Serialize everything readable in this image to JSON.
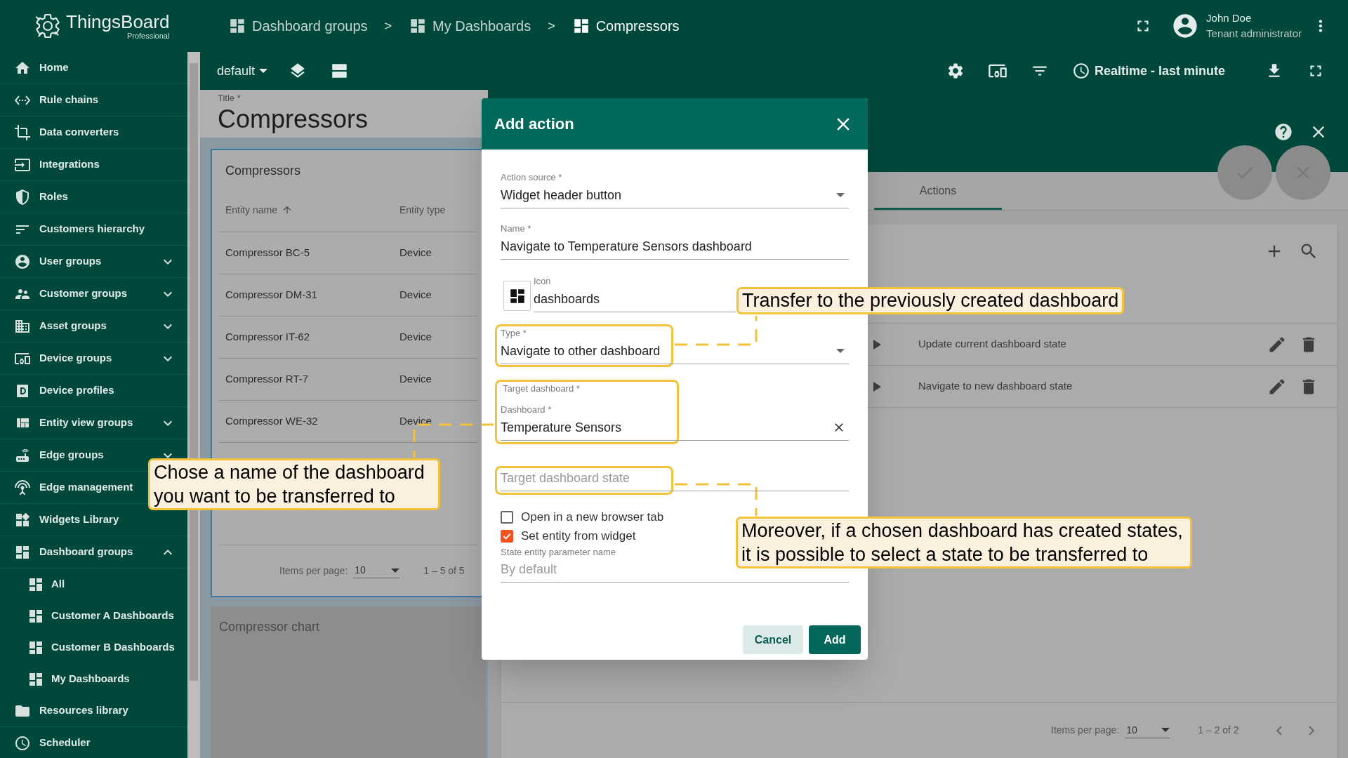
{
  "app": {
    "name": "ThingsBoard",
    "edition": "Professional"
  },
  "breadcrumbs": [
    {
      "label": "Dashboard groups",
      "separator": ">"
    },
    {
      "label": "My Dashboards",
      "separator": ">"
    },
    {
      "label": "Compressors"
    }
  ],
  "user": {
    "name": "John Doe",
    "role": "Tenant administrator"
  },
  "sidebar": {
    "items": [
      {
        "label": "Home",
        "kind": "link"
      },
      {
        "label": "Rule chains",
        "kind": "link"
      },
      {
        "label": "Data converters",
        "kind": "link"
      },
      {
        "label": "Integrations",
        "kind": "link"
      },
      {
        "label": "Roles",
        "kind": "link"
      },
      {
        "label": "Customers hierarchy",
        "kind": "link"
      },
      {
        "label": "User groups",
        "kind": "group",
        "expanded": false
      },
      {
        "label": "Customer groups",
        "kind": "group",
        "expanded": false
      },
      {
        "label": "Asset groups",
        "kind": "group",
        "expanded": false
      },
      {
        "label": "Device groups",
        "kind": "group",
        "expanded": false
      },
      {
        "label": "Device profiles",
        "kind": "link"
      },
      {
        "label": "Entity view groups",
        "kind": "group",
        "expanded": false
      },
      {
        "label": "Edge groups",
        "kind": "group",
        "expanded": false
      },
      {
        "label": "Edge management",
        "kind": "link"
      },
      {
        "label": "Widgets Library",
        "kind": "link"
      },
      {
        "label": "Dashboard groups",
        "kind": "group",
        "expanded": true,
        "children": [
          {
            "label": "All"
          },
          {
            "label": "Customer A Dashboards"
          },
          {
            "label": "Customer B Dashboards"
          },
          {
            "label": "My Dashboards"
          }
        ]
      },
      {
        "label": "Resources library",
        "kind": "link"
      },
      {
        "label": "Scheduler",
        "kind": "link"
      }
    ]
  },
  "toolbar": {
    "state": "default",
    "timewindow": "Realtime - last minute"
  },
  "dashboard": {
    "title_label": "Title *",
    "title": "Compressors",
    "table_widget": {
      "title": "Compressors",
      "columns": [
        {
          "label": "Entity name",
          "sorted": true
        },
        {
          "label": "Entity type",
          "sorted": false
        }
      ],
      "rows": [
        [
          "Compressor BC-5",
          "Device"
        ],
        [
          "Compressor DM-31",
          "Device"
        ],
        [
          "Compressor IT-62",
          "Device"
        ],
        [
          "Compressor RT-7",
          "Device"
        ],
        [
          "Compressor WE-32",
          "Device"
        ]
      ],
      "items_per_page_label": "Items per page:",
      "items_per_page": "10",
      "range": "1 – 5 of 5"
    },
    "chart_widget": {
      "title": "Compressor chart"
    }
  },
  "widget_editor": {
    "tabs": [
      {
        "label": "Actions",
        "selected": true
      }
    ],
    "actions": [
      {
        "name": "Update current dashboard state"
      },
      {
        "name": "Navigate to new dashboard state"
      }
    ],
    "items_per_page_label": "Items per page:",
    "items_per_page": "10",
    "range": "1 – 2 of 2"
  },
  "dialog": {
    "title": "Add action",
    "items": [
      {
        "kind": "select",
        "label": "Action source *",
        "value": "Widget header button"
      },
      {
        "kind": "text",
        "label": "Name *",
        "value": "Navigate to Temperature Sensors dashboard"
      },
      {
        "kind": "icon",
        "label": "Icon",
        "value": "dashboards"
      },
      {
        "kind": "select",
        "label": "Type *",
        "value": "Navigate to other dashboard"
      },
      {
        "kind": "autocomplete",
        "group_label": "Target dashboard *",
        "label": "Dashboard *",
        "value": "Temperature Sensors"
      },
      {
        "kind": "text",
        "placeholder": "Target dashboard state"
      },
      {
        "kind": "checkbox",
        "label": "Open in a new browser tab",
        "checked": false
      },
      {
        "kind": "checkbox",
        "label": "Set entity from widget",
        "checked": true
      },
      {
        "kind": "text",
        "label": "State entity parameter name",
        "placeholder": "By default"
      }
    ],
    "buttons": [
      {
        "label": "Cancel",
        "kind": "secondary"
      },
      {
        "label": "Add",
        "kind": "primary"
      }
    ]
  },
  "callouts": [
    {
      "text": "Transfer to the previously created dashboard"
    },
    {
      "text": "Chose a name of the dashboard you want to be transferred to"
    },
    {
      "text": "Moreover, if a chosen dashboard has created states, it is possible to select a state to be transferred to"
    }
  ]
}
